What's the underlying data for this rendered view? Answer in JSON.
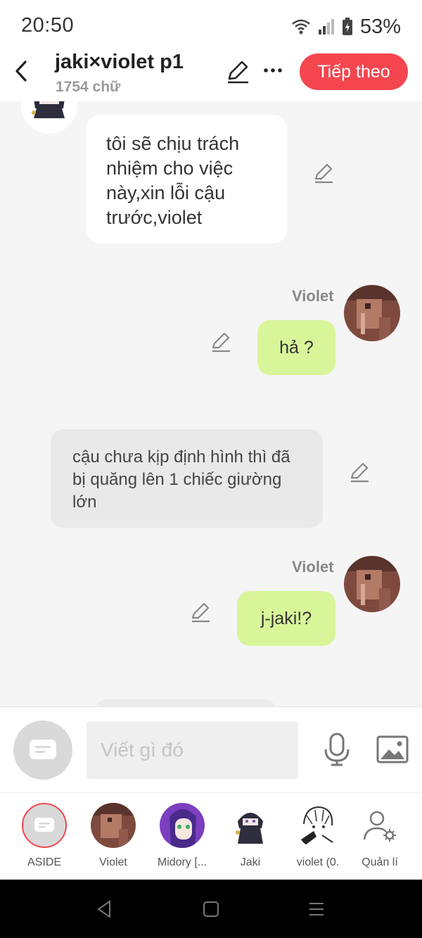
{
  "status_bar": {
    "time": "20:50",
    "battery": "53%"
  },
  "header": {
    "title": "jaki×violet p1",
    "subtitle": "1754 chữ",
    "next_label": "Tiếp theo"
  },
  "messages": {
    "m1": "tôi sẽ chịu trách nhiệm cho việc này,xin lỗi cậu trước,violet",
    "m2_name": "Violet",
    "m2": "hả ?",
    "m3": "cậu chưa kịp định hình thì đã bị quăng lên 1 chiếc giường lớn",
    "m4_name": "Violet",
    "m4": "j-jaki!?"
  },
  "composer": {
    "placeholder": "Viết gì đó"
  },
  "characters": [
    {
      "label": "ASIDE"
    },
    {
      "label": "Violet"
    },
    {
      "label": "Midory [..."
    },
    {
      "label": "Jaki"
    },
    {
      "label": "violet (0."
    },
    {
      "label": "Quản lí"
    }
  ],
  "colors": {
    "accent": "#f5464f",
    "user_bubble": "#d8f59a",
    "narration_bubble": "#e9e9e9"
  }
}
